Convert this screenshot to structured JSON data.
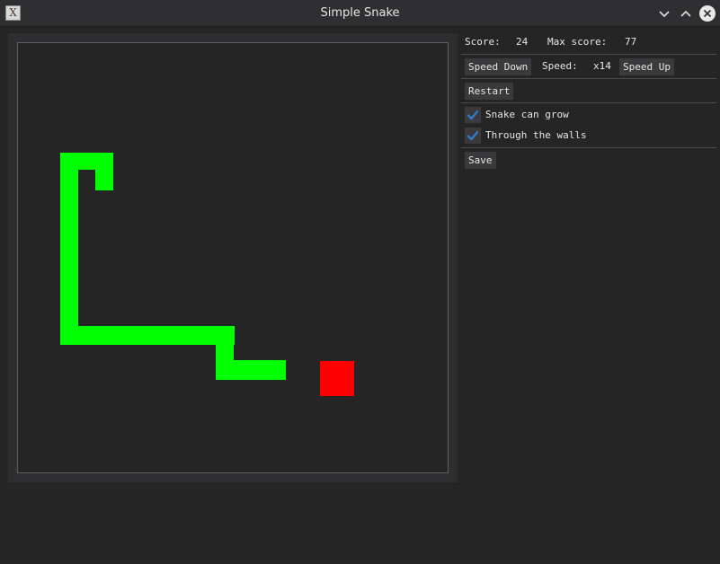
{
  "window": {
    "title": "Simple Snake",
    "app_icon": "X"
  },
  "panel": {
    "score_label": "Score:",
    "score_value": "24",
    "max_score_label": "Max score:",
    "max_score_value": "77",
    "speed_down_label": "Speed Down",
    "speed_label": "Speed:",
    "speed_value": "x14",
    "speed_up_label": "Speed Up",
    "restart_label": "Restart",
    "snake_can_grow_label": "Snake can grow",
    "snake_can_grow_checked": true,
    "through_walls_label": "Through the walls",
    "through_walls_checked": true,
    "save_label": "Save"
  },
  "colors": {
    "snake": "#00ff00",
    "food": "#ff0000",
    "board_background": "#252525",
    "checkmark": "#2f7fd6"
  }
}
